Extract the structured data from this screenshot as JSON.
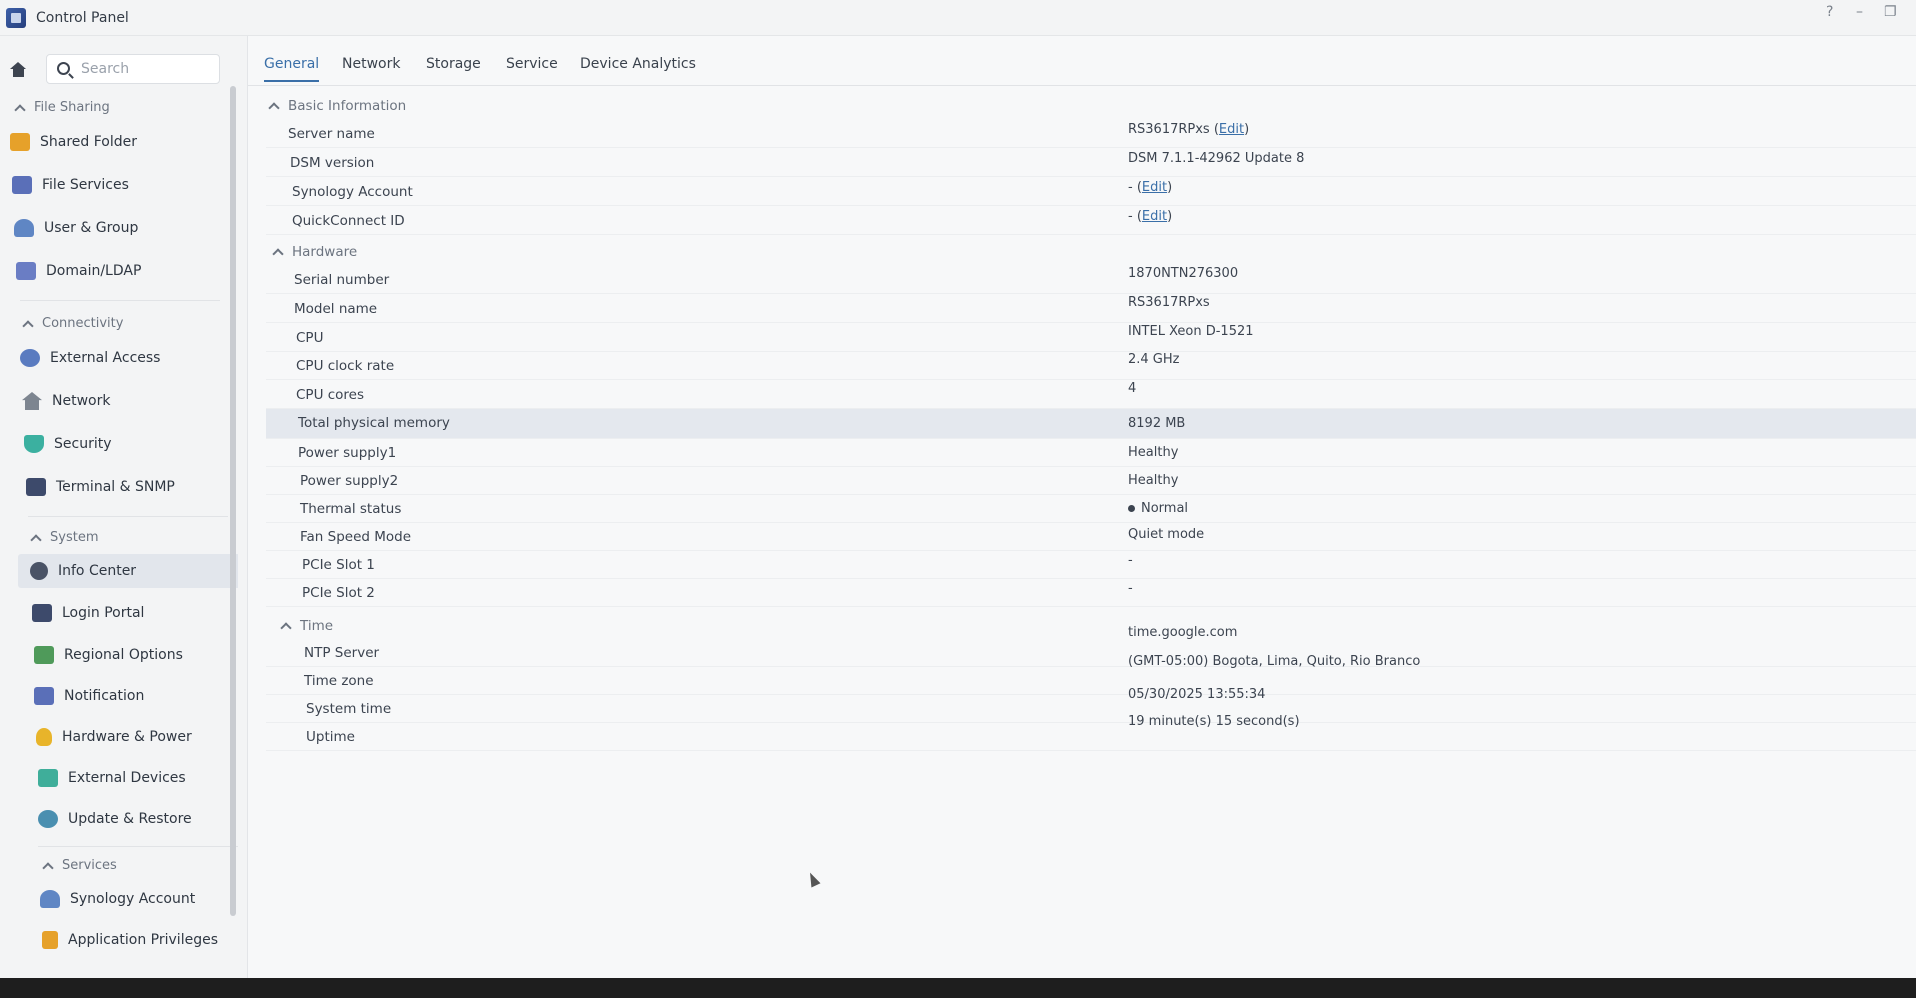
{
  "window": {
    "title": "Control Panel",
    "help": "?",
    "minimize": "–",
    "restore": "❐"
  },
  "search": {
    "placeholder": "Search"
  },
  "sidebar": {
    "sections": [
      {
        "label": "File Sharing"
      },
      {
        "label": "Connectivity"
      },
      {
        "label": "System"
      },
      {
        "label": "Services"
      }
    ],
    "items": [
      {
        "label": "Shared Folder",
        "icon": "folder-icon",
        "color": "#e6a12a"
      },
      {
        "label": "File Services",
        "icon": "file-services-icon",
        "color": "#5a6fb8"
      },
      {
        "label": "User & Group",
        "icon": "user-group-icon",
        "color": "#5f86c4"
      },
      {
        "label": "Domain/LDAP",
        "icon": "domain-icon",
        "color": "#6a7dc4"
      },
      {
        "label": "External Access",
        "icon": "external-access-icon",
        "color": "#5a7bc0"
      },
      {
        "label": "Network",
        "icon": "network-icon",
        "color": "#7d8590"
      },
      {
        "label": "Security",
        "icon": "shield-icon",
        "color": "#3bb0a0"
      },
      {
        "label": "Terminal & SNMP",
        "icon": "terminal-icon",
        "color": "#3d4a6b"
      },
      {
        "label": "Info Center",
        "icon": "info-icon",
        "color": "#4a5366"
      },
      {
        "label": "Login Portal",
        "icon": "login-portal-icon",
        "color": "#3d4a6b"
      },
      {
        "label": "Regional Options",
        "icon": "regional-icon",
        "color": "#4f9a5a"
      },
      {
        "label": "Notification",
        "icon": "notification-icon",
        "color": "#5a6fb8"
      },
      {
        "label": "Hardware & Power",
        "icon": "bulb-icon",
        "color": "#e8b42a"
      },
      {
        "label": "External Devices",
        "icon": "external-devices-icon",
        "color": "#3fae9a"
      },
      {
        "label": "Update & Restore",
        "icon": "update-icon",
        "color": "#4a8fb0"
      },
      {
        "label": "Synology Account",
        "icon": "synology-account-icon",
        "color": "#5f86c4"
      },
      {
        "label": "Application Privileges",
        "icon": "lock-icon",
        "color": "#e6a12a"
      }
    ]
  },
  "tabs": [
    "General",
    "Network",
    "Storage",
    "Service",
    "Device Analytics"
  ],
  "basic": {
    "title": "Basic Information",
    "rows": [
      {
        "label": "Server name",
        "value": "RS3617RPxs (",
        "edit": "Edit",
        "tail": ")"
      },
      {
        "label": "DSM version",
        "value": "DSM 7.1.1-42962 Update 8"
      },
      {
        "label": "Synology Account",
        "value": "- (",
        "edit": "Edit",
        "tail": ")"
      },
      {
        "label": "QuickConnect ID",
        "value": "- (",
        "edit": "Edit",
        "tail": ")"
      }
    ]
  },
  "hardware": {
    "title": "Hardware",
    "rows": [
      {
        "label": "Serial number",
        "value": "1870NTN276300"
      },
      {
        "label": "Model name",
        "value": "RS3617RPxs"
      },
      {
        "label": "CPU",
        "value": "INTEL Xeon D-1521"
      },
      {
        "label": "CPU clock rate",
        "value": "2.4 GHz"
      },
      {
        "label": "CPU cores",
        "value": "4"
      },
      {
        "label": "Total physical memory",
        "value": "8192 MB"
      },
      {
        "label": "Power supply1",
        "value": "Healthy"
      },
      {
        "label": "Power supply2",
        "value": "Healthy"
      },
      {
        "label": "Thermal status",
        "value": "Normal"
      },
      {
        "label": "Fan Speed Mode",
        "value": "Quiet mode"
      },
      {
        "label": "PCIe Slot 1",
        "value": "-"
      },
      {
        "label": "PCIe Slot 2",
        "value": "-"
      }
    ]
  },
  "time": {
    "title": "Time",
    "rows": [
      {
        "label": "NTP Server",
        "value": "time.google.com"
      },
      {
        "label": "Time zone",
        "value": "(GMT-05:00) Bogota, Lima, Quito, Rio Branco"
      },
      {
        "label": "System time",
        "value": "05/30/2025 13:55:34"
      },
      {
        "label": "Uptime",
        "value": "19 minute(s) 15 second(s)"
      }
    ]
  }
}
